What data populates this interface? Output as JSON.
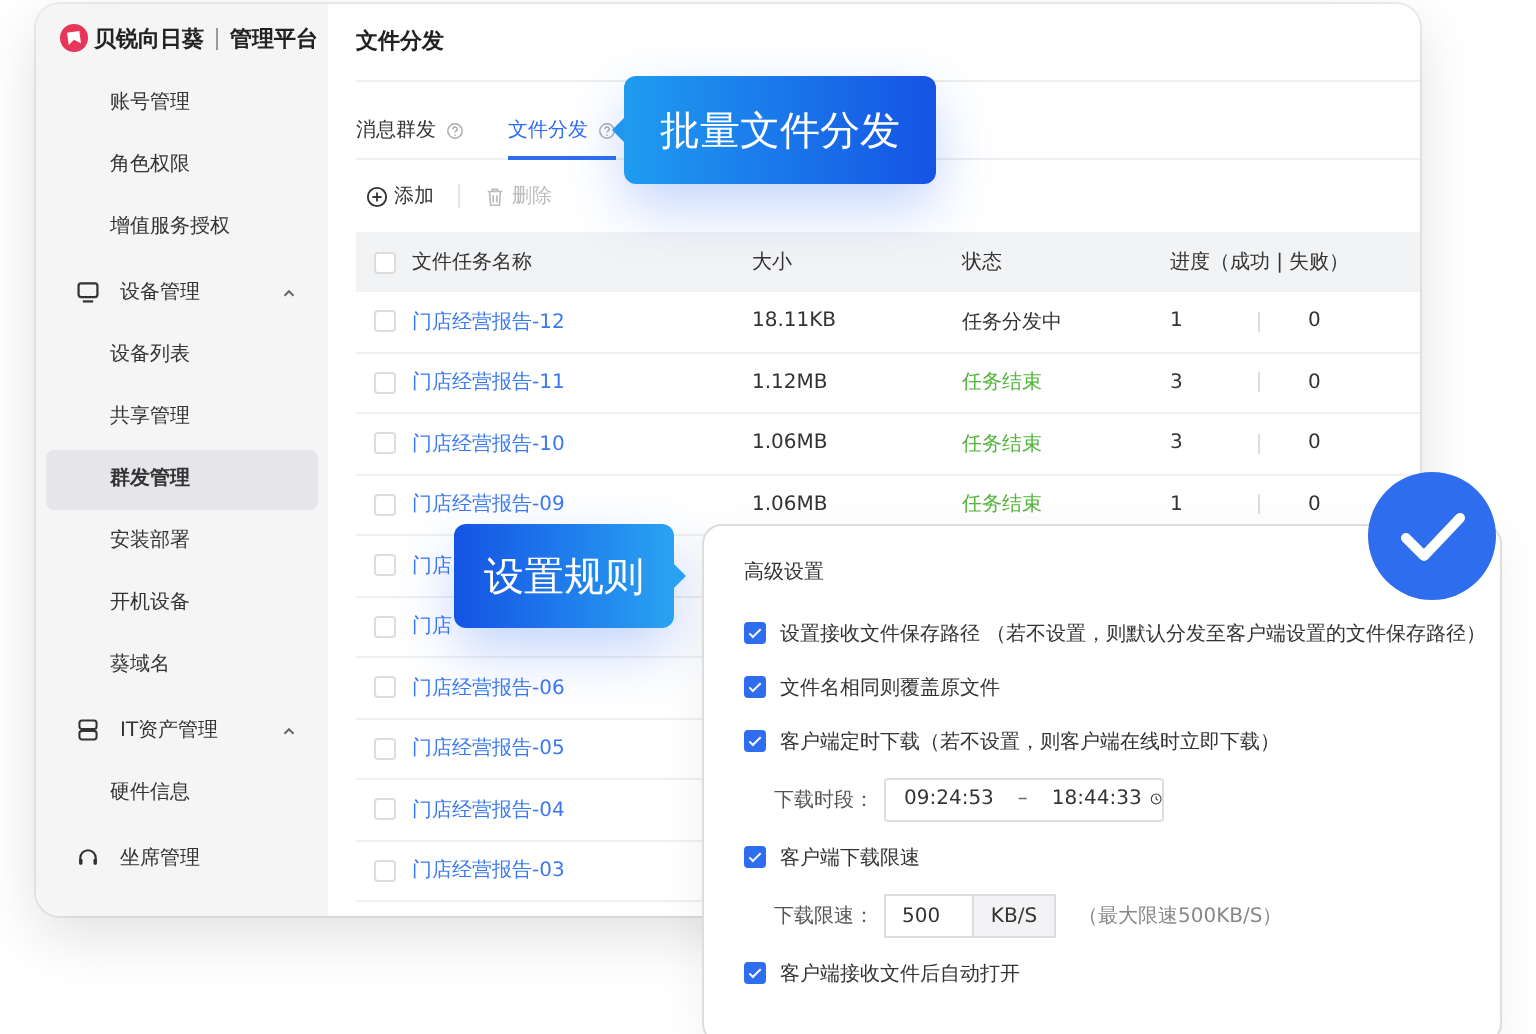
{
  "brand": {
    "name": "贝锐向日葵",
    "product": "管理平台"
  },
  "sidebar": {
    "items": [
      {
        "kind": "item",
        "label": "账号管理",
        "selected": false
      },
      {
        "kind": "item",
        "label": "角色权限",
        "selected": false
      },
      {
        "kind": "item",
        "label": "增值服务授权",
        "selected": false
      },
      {
        "kind": "group",
        "label": "设备管理",
        "expanded": true,
        "children": [
          {
            "label": "设备列表",
            "selected": false
          },
          {
            "label": "共享管理",
            "selected": false
          },
          {
            "label": "群发管理",
            "selected": true
          },
          {
            "label": "安装部署",
            "selected": false
          },
          {
            "label": "开机设备",
            "selected": false
          },
          {
            "label": "葵域名",
            "selected": false
          }
        ]
      },
      {
        "kind": "group",
        "label": "IT资产管理",
        "expanded": true,
        "children": [
          {
            "label": "硬件信息",
            "selected": false
          }
        ]
      },
      {
        "kind": "group",
        "label": "坐席管理"
      }
    ]
  },
  "page_title": "文件分发",
  "tabs": [
    {
      "label": "消息群发",
      "selected": false
    },
    {
      "label": "文件分发",
      "selected": true
    }
  ],
  "toolbar": [
    {
      "kind": "add",
      "label": "添加",
      "disabled": false
    },
    {
      "kind": "delete",
      "label": "删除",
      "disabled": true
    }
  ],
  "table": {
    "header_checked": false,
    "columns": [
      "文件任务名称",
      "大小",
      "状态",
      "进度（成功 | 失败）"
    ],
    "rows": [
      {
        "name": "门店经营报告-12",
        "size": "18.11KB",
        "status": "任务分发中",
        "finished": false,
        "success": "1",
        "fail": "0",
        "checked": false
      },
      {
        "name": "门店经营报告-11",
        "size": "1.12MB",
        "status": "任务结束",
        "finished": true,
        "success": "3",
        "fail": "0",
        "checked": false
      },
      {
        "name": "门店经营报告-10",
        "size": "1.06MB",
        "status": "任务结束",
        "finished": true,
        "success": "3",
        "fail": "0",
        "checked": false
      },
      {
        "name": "门店经营报告-09",
        "size": "1.06MB",
        "status": "任务结束",
        "finished": true,
        "success": "1",
        "fail": "0",
        "checked": false
      },
      {
        "name": "门店",
        "checked": false
      },
      {
        "name": "门店",
        "checked": false
      },
      {
        "name": "门店经营报告-06",
        "checked": false
      },
      {
        "name": "门店经营报告-05",
        "checked": false
      },
      {
        "name": "门店经营报告-04",
        "checked": false
      },
      {
        "name": "门店经营报告-03",
        "checked": false
      }
    ]
  },
  "callouts": [
    {
      "text": "批量文件分发"
    },
    {
      "text": "设置规则"
    }
  ],
  "settings": {
    "title": "高级设置",
    "options": [
      {
        "kind": "check",
        "label": "设置接收文件保存路径 （若不设置，则默认分发至客户端设置的文件保存路径）",
        "checked": true
      },
      {
        "kind": "check",
        "label": "文件名相同则覆盖原文件",
        "checked": true
      },
      {
        "kind": "check",
        "label": "客户端定时下载（若不设置，则客户端在线时立即下载）",
        "checked": true
      },
      {
        "kind": "time_range",
        "label": "下载时段：",
        "start": "09:24:53",
        "separator": "–",
        "end": "18:44:33"
      },
      {
        "kind": "check",
        "label": "客户端下载限速",
        "checked": true
      },
      {
        "kind": "speed",
        "label": "下载限速：",
        "value": "500",
        "unit": "KB/S",
        "hint": "（最大限速500KB/S）"
      },
      {
        "kind": "check",
        "label": "客户端接收文件后自动打开",
        "checked": true
      }
    ]
  }
}
